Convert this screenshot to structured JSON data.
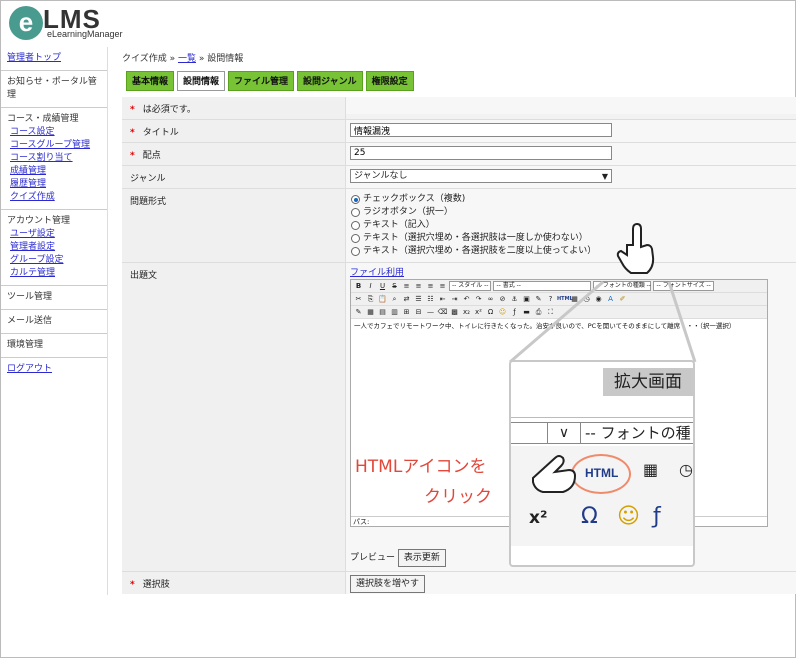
{
  "logo": {
    "mark": "e",
    "title": "LMS",
    "subtitle": "eLearningManager"
  },
  "sidebar": {
    "admin_top": "管理者トップ",
    "news": "お知らせ・ポータル管理",
    "course_section": "コース・成績管理",
    "course_items": [
      "コース設定",
      "コースグループ管理",
      "コース割り当て",
      "成績管理",
      "履歴管理",
      "クイズ作成"
    ],
    "account_section": "アカウント管理",
    "account_items": [
      "ユーザ設定",
      "管理者設定",
      "グループ設定",
      "カルテ管理"
    ],
    "tools": "ツール管理",
    "mail": "メール送信",
    "env": "環境管理",
    "logout": "ログアウト"
  },
  "breadcrumb": {
    "part1": "クイズ作成 » ",
    "link": "一覧",
    "part2": " » 設問情報"
  },
  "tabs": [
    "基本情報",
    "設問情報",
    "ファイル管理",
    "設問ジャンル",
    "権限設定"
  ],
  "form": {
    "required_note": "は必須です。",
    "required_mark": "*",
    "title_label": "タイトル",
    "title_value": "情報漏洩",
    "points_label": "配点",
    "points_value": "25",
    "genre_label": "ジャンル",
    "genre_value": "ジャンルなし",
    "type_label": "問題形式",
    "type_options": [
      "チェックボックス（複数)",
      "ラジオボタン（択一）",
      "テキスト（記入）",
      "テキスト（選択穴埋め・各選択肢は一度しか使わない）",
      "テキスト（選択穴埋め・各選択肢を二度以上使ってよい）"
    ],
    "question_label": "出題文",
    "file_link": "ファイル利用",
    "editor_text": "一人でカフェでリモートワーク中、トイレに行きたくなった。治安が良いので、PCを開いてそのままにして離席・・・（択一選択）",
    "editor_style": "-- スタイル --",
    "editor_format": "-- 書式 --",
    "editor_font": "-- フォントの種類 --",
    "editor_size": "-- フォントサイズ --",
    "path_label": "パス:",
    "preview_label": "プレビュー",
    "refresh_button": "表示更新",
    "choices_label": "選択肢",
    "add_choice_button": "選択肢を増やす"
  },
  "callout": {
    "title": "拡大画面",
    "dropdown_caret": "∨",
    "font_text": "-- フォントの種",
    "html_icon": "HTML",
    "note_line1": "HTMLアイコンを",
    "note_line2": "クリック"
  },
  "colors": {
    "tab_green": "#77c235",
    "accent_red": "#e2473a",
    "link_blue": "#2a2ad0",
    "logo_teal": "#4a9b8f"
  }
}
